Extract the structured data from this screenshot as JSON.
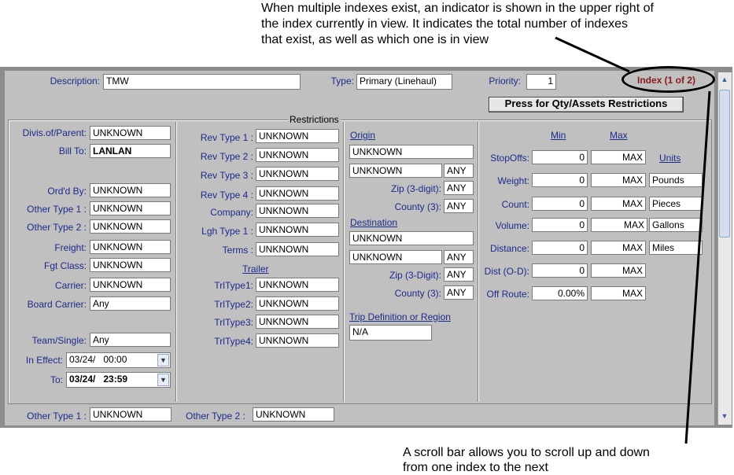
{
  "annotations": {
    "top": [
      "When multiple indexes exist, an indicator is shown in the upper right of",
      "the index currently in view. It indicates the total number of indexes",
      "that exist, as well as which one is in view"
    ],
    "bottom": [
      "A scroll bar allows you to scroll up and down",
      "from one index to the next"
    ]
  },
  "header": {
    "description_label": "Description:",
    "description_value": "TMW",
    "type_label": "Type:",
    "type_value": "Primary (Linehaul)",
    "priority_label": "Priority:",
    "priority_value": "1",
    "index_indicator": "Index (1 of 2)",
    "qty_button": "Press for Qty/Assets Restrictions"
  },
  "restrictions_title": "Restrictions",
  "col1": [
    {
      "label": "Divis.of/Parent:",
      "value": "UNKNOWN"
    },
    {
      "label": "Bill To:",
      "value": "LANLAN"
    },
    {
      "label": "Ord'd By:",
      "value": "UNKNOWN"
    },
    {
      "label": "Other Type 1 :",
      "value": "UNKNOWN"
    },
    {
      "label": "Other Type 2 :",
      "value": "UNKNOWN"
    },
    {
      "label": "Freight:",
      "value": "UNKNOWN"
    },
    {
      "label": "Fgt Class:",
      "value": "UNKNOWN"
    },
    {
      "label": "Carrier:",
      "value": "UNKNOWN"
    },
    {
      "label": "Board Carrier:",
      "value": "Any"
    },
    {
      "label": "Team/Single:",
      "value": "Any"
    },
    {
      "label": "In Effect:",
      "value": "03/24/   00:00"
    },
    {
      "label": "To:",
      "value": "03/24/   23:59"
    }
  ],
  "col2": [
    {
      "label": "Rev Type 1 :",
      "value": "UNKNOWN"
    },
    {
      "label": "Rev Type 2 :",
      "value": "UNKNOWN"
    },
    {
      "label": "Rev Type 3 :",
      "value": "UNKNOWN"
    },
    {
      "label": "Rev Type 4 :",
      "value": "UNKNOWN"
    },
    {
      "label": "Company:",
      "value": "UNKNOWN"
    },
    {
      "label": "Lgh Type 1 :",
      "value": "UNKNOWN"
    },
    {
      "label": "Terms :",
      "value": "UNKNOWN"
    },
    {
      "label": "Trailer",
      "value": ""
    },
    {
      "label": "TrlType1:",
      "value": "UNKNOWN"
    },
    {
      "label": "TrlType2:",
      "value": "UNKNOWN"
    },
    {
      "label": "TrlType3:",
      "value": "UNKNOWN"
    },
    {
      "label": "TrlType4:",
      "value": "UNKNOWN"
    }
  ],
  "col3": {
    "origin_label": "Origin",
    "origin_value": "UNKNOWN",
    "origin_value2": "UNKNOWN",
    "origin_any": "ANY",
    "origin_zip_label": "Zip (3-digit):",
    "origin_zip": "ANY",
    "origin_county_label": "County (3):",
    "origin_county": "ANY",
    "dest_label": "Destination",
    "dest_value": "UNKNOWN",
    "dest_value2": "UNKNOWN",
    "dest_any": "ANY",
    "dest_zip_label": "Zip (3-Digit):",
    "dest_zip": "ANY",
    "dest_county_label": "County (3):",
    "dest_county": "ANY",
    "trip_label": "Trip Definition or Region",
    "trip_value": "N/A"
  },
  "col4": {
    "min_label": "Min",
    "max_label": "Max",
    "units_label": "Units",
    "rows": [
      {
        "label": "StopOffs:",
        "min": "0",
        "max": "MAX",
        "unit": ""
      },
      {
        "label": "Weight:",
        "min": "0",
        "max": "MAX",
        "unit": "Pounds"
      },
      {
        "label": "Count:",
        "min": "0",
        "max": "MAX",
        "unit": "Pieces"
      },
      {
        "label": "Volume:",
        "min": "0",
        "max": "MAX",
        "unit": "Gallons"
      },
      {
        "label": "Distance:",
        "min": "0",
        "max": "MAX",
        "unit": "Miles"
      },
      {
        "label": "Dist (O-D):",
        "min": "0",
        "max": "MAX",
        "unit": ""
      },
      {
        "label": "Off Route:",
        "min": "0.00%",
        "max": "MAX",
        "unit": ""
      }
    ]
  },
  "footer": {
    "other1_label": "Other Type 1 :",
    "other1_value": "UNKNOWN",
    "other2_label": "Other Type 2 :",
    "other2_value": "UNKNOWN"
  },
  "colors": {
    "indicator": "#8b1a1a",
    "label": "#1c2a8c",
    "panel": "#c0c0c0"
  },
  "icons": [
    "scroll-up-icon",
    "scroll-down-icon",
    "dropdown-arrow-icon"
  ]
}
